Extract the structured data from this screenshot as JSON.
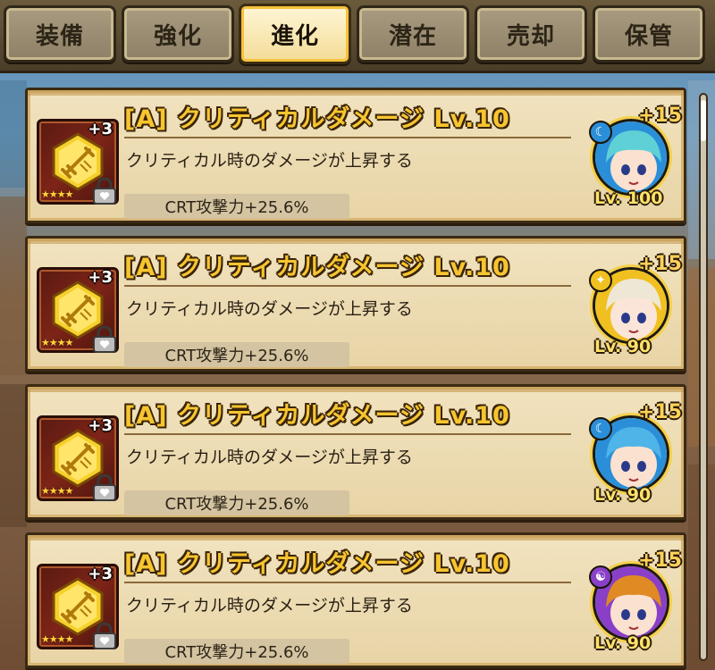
{
  "tabs": [
    {
      "label": "装備",
      "active": false
    },
    {
      "label": "強化",
      "active": false
    },
    {
      "label": "進化",
      "active": true
    },
    {
      "label": "潜在",
      "active": false
    },
    {
      "label": "売却",
      "active": false
    },
    {
      "label": "保管",
      "active": false
    }
  ],
  "runes": [
    {
      "title": "[A] クリティカルダメージ Lv.10",
      "description": "クリティカル時のダメージが上昇する",
      "stat": "CRT攻撃力+25.6%",
      "plus": "+3",
      "stars": "★★★★",
      "character": {
        "plus": "+15",
        "level": "Lv. 100",
        "element_icon": "water-icon",
        "element_color": "#2a8fd8",
        "hair_color": "#5fd0d6",
        "skin": "#fbe1cf"
      }
    },
    {
      "title": "[A] クリティカルダメージ Lv.10",
      "description": "クリティカル時のダメージが上昇する",
      "stat": "CRT攻撃力+25.6%",
      "plus": "+3",
      "stars": "★★★★",
      "character": {
        "plus": "+15",
        "level": "Lv. 90",
        "element_icon": "light-icon",
        "element_color": "#f0c020",
        "hair_color": "#efe7d6",
        "skin": "#fbe5d8"
      }
    },
    {
      "title": "[A] クリティカルダメージ Lv.10",
      "description": "クリティカル時のダメージが上昇する",
      "stat": "CRT攻撃力+25.6%",
      "plus": "+3",
      "stars": "★★★★",
      "character": {
        "plus": "+15",
        "level": "Lv. 90",
        "element_icon": "water-icon",
        "element_color": "#2a8fd8",
        "hair_color": "#4fb4e8",
        "skin": "#fbe1cf"
      }
    },
    {
      "title": "[A] クリティカルダメージ Lv.10",
      "description": "クリティカル時のダメージが上昇する",
      "stat": "CRT攻撃力+25.6%",
      "plus": "+3",
      "stars": "★★★★",
      "character": {
        "plus": "+15",
        "level": "Lv. 90",
        "element_icon": "dark-icon",
        "element_color": "#8a3fc8",
        "hair_color": "#e08a24",
        "skin": "#fbe1cf"
      }
    }
  ]
}
